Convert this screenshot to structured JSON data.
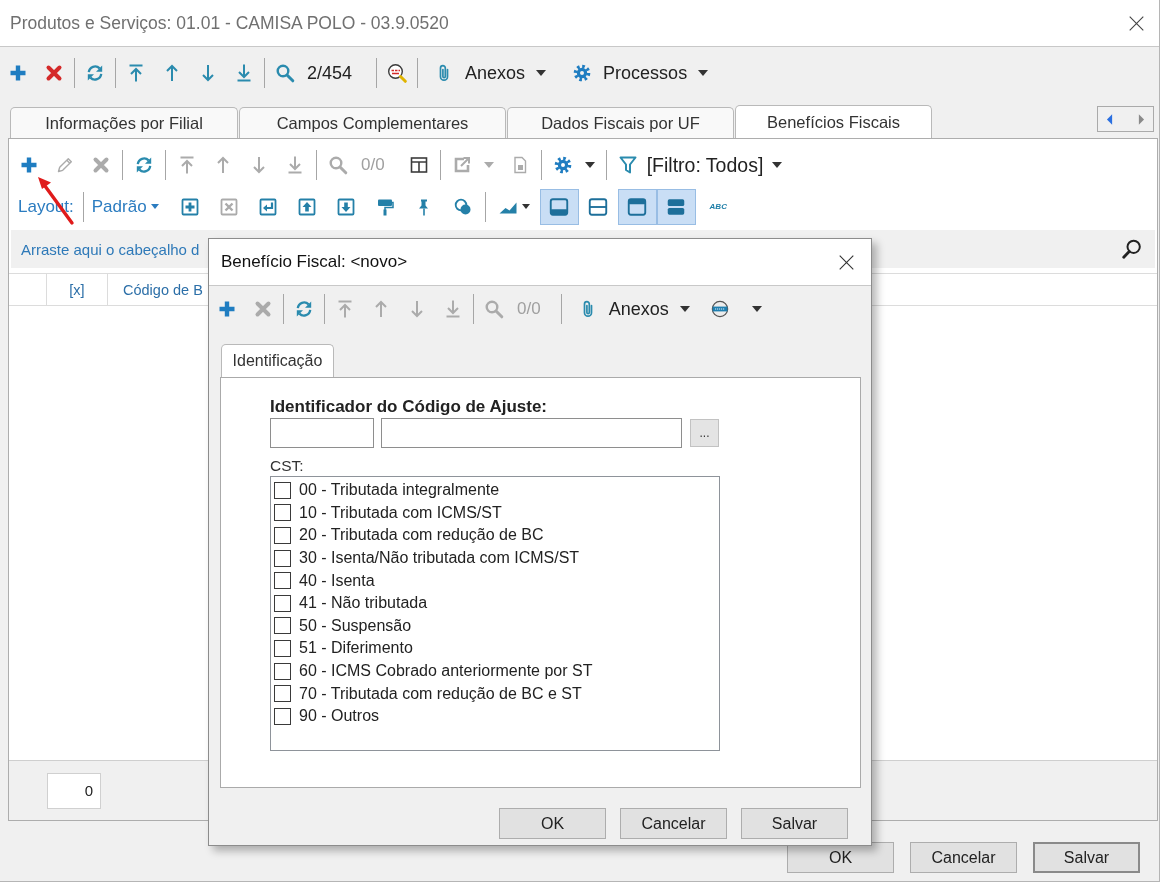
{
  "window": {
    "title": "Produtos e Serviços: 01.01 - CAMISA POLO - 03.9.0520"
  },
  "toolbar": {
    "counter": "2/454",
    "menus": [
      {
        "label": "Anexos"
      },
      {
        "label": "Processos"
      }
    ]
  },
  "tabs": [
    {
      "label": "Informações por Filial",
      "selected": false
    },
    {
      "label": "Campos Complementares",
      "selected": false
    },
    {
      "label": "Dados Fiscais por UF",
      "selected": false
    },
    {
      "label": "Benefícios Fiscais",
      "selected": true
    }
  ],
  "tab_scroll": {
    "left_disabled": false,
    "right_disabled": true
  },
  "grid_toolbar": {
    "buttons": [
      {
        "disabled": false
      },
      {
        "disabled": true
      },
      {
        "disabled": true
      },
      {
        "disabled": false
      },
      {
        "disabled": true
      },
      {
        "disabled": true
      },
      {
        "disabled": true
      },
      {
        "disabled": true
      },
      {
        "disabled": true
      },
      {
        "disabled": false
      },
      {
        "disabled": true
      },
      {
        "disabled": true
      },
      {
        "disabled": false
      }
    ],
    "counter": {
      "text": "0/0",
      "disabled": true
    },
    "filter": "[Filtro: Todos]"
  },
  "layout_bar": {
    "label": "Layout:",
    "preset": "Padrão",
    "buttons": [
      {
        "disabled": false
      },
      {
        "disabled": true
      },
      {
        "disabled": false
      },
      {
        "disabled": false
      },
      {
        "disabled": false
      },
      {
        "disabled": false
      },
      {
        "disabled": false
      },
      {
        "disabled": false
      },
      {
        "disabled": false
      }
    ],
    "views": [
      {
        "selected": true
      },
      {
        "selected": false
      },
      {
        "selected": true
      },
      {
        "selected": true
      }
    ],
    "spellcheck": "ABC"
  },
  "group_panel": {
    "hint": "Arraste aqui o cabeçalho d"
  },
  "grid": {
    "columns": [
      "[x]",
      "Código de B"
    ]
  },
  "footer": {
    "count": "0"
  },
  "buttons": [
    {
      "label": "OK",
      "default": false
    },
    {
      "label": "Cancelar",
      "default": false
    },
    {
      "label": "Salvar",
      "default": true
    }
  ],
  "dialog": {
    "title": "Benefício Fiscal: <novo>",
    "toolbar": {
      "buttons": [
        {
          "disabled": false
        },
        {
          "disabled": true
        },
        {
          "disabled": false
        },
        {
          "disabled": true
        },
        {
          "disabled": true
        },
        {
          "disabled": true
        },
        {
          "disabled": true
        },
        {
          "disabled": true
        },
        {
          "disabled": false
        }
      ],
      "counter": {
        "text": "0/0",
        "disabled": true
      },
      "menus": [
        {
          "label": "Anexos"
        }
      ]
    },
    "tabs": [
      {
        "label": "Identificação",
        "selected": true
      }
    ],
    "adjustment_code": {
      "label": "Identificador do Código de Ajuste:",
      "browse": "..."
    },
    "cst": {
      "label": "CST:",
      "options": [
        {
          "label": "00 - Tributada integralmente",
          "checked": false
        },
        {
          "label": "10 - Tributada com ICMS/ST",
          "checked": false
        },
        {
          "label": "20 - Tributada com redução de BC",
          "checked": false
        },
        {
          "label": "30 - Isenta/Não tributada com ICMS/ST",
          "checked": false
        },
        {
          "label": "40 - Isenta",
          "checked": false
        },
        {
          "label": "41 - Não tributada",
          "checked": false
        },
        {
          "label": "50 - Suspensão",
          "checked": false
        },
        {
          "label": "51 - Diferimento",
          "checked": false
        },
        {
          "label": "60 - ICMS Cobrado anteriormente por ST",
          "checked": false
        },
        {
          "label": "70 - Tributada com redução de BC e ST",
          "checked": false
        },
        {
          "label": "90 - Outros",
          "checked": false
        }
      ]
    },
    "buttons": [
      {
        "label": "OK",
        "default": false
      },
      {
        "label": "Cancelar",
        "default": false
      },
      {
        "label": "Salvar",
        "default": false
      }
    ]
  }
}
